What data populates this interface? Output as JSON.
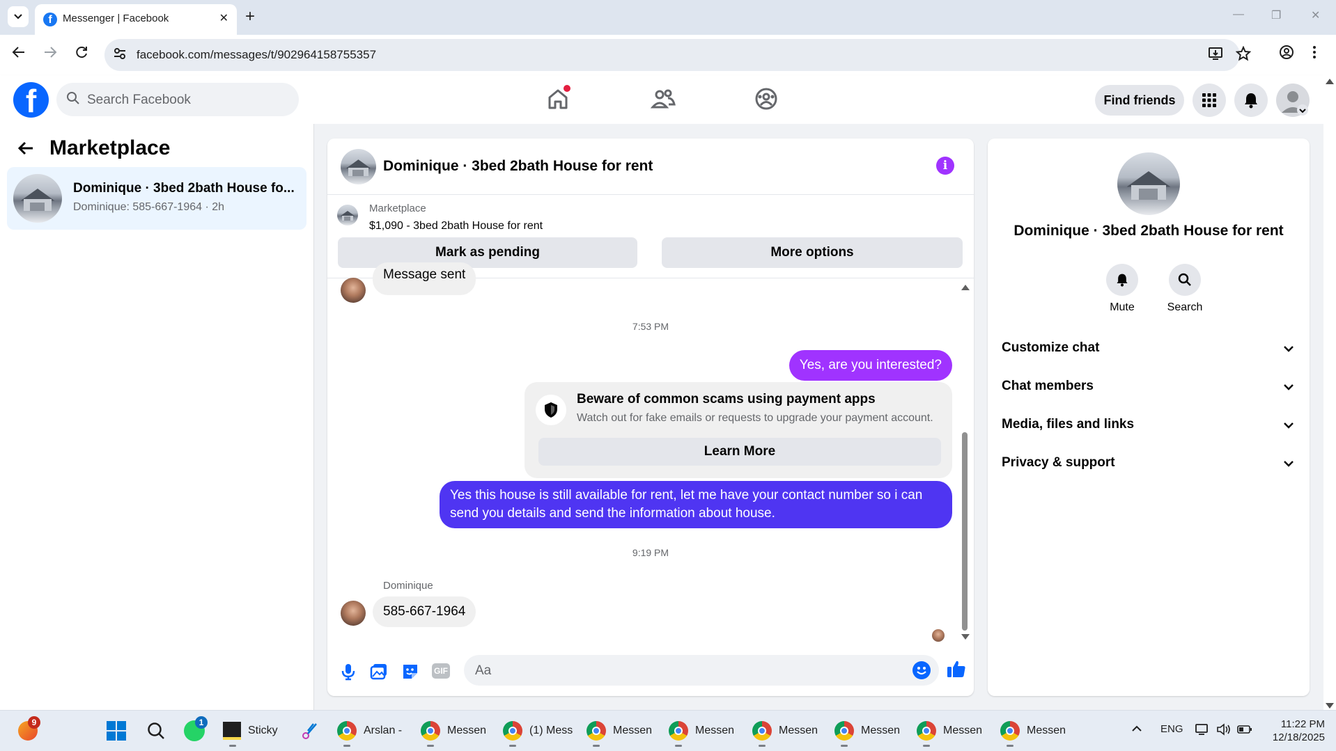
{
  "browser": {
    "tab_title": "Messenger | Facebook",
    "url": "facebook.com/messages/t/902964158755357"
  },
  "fb": {
    "search_placeholder": "Search Facebook",
    "find_friends": "Find friends"
  },
  "left": {
    "title": "Marketplace",
    "conversation": {
      "name": "Dominique · 3bed 2bath House fo...",
      "preview": "Dominique: 585-667-1964 · 2h"
    }
  },
  "chat": {
    "title": "Dominique · 3bed 2bath House for rent",
    "listing_label": "Marketplace",
    "listing_value": "$1,090 - 3bed 2bath House for rent",
    "mark_pending": "Mark as pending",
    "more_options": "More options",
    "messages": {
      "m1": "Message sent",
      "ts1": "7:53 PM",
      "m2": "Yes, are you interested?",
      "scam_title": "Beware of common scams using payment apps",
      "scam_sub": "Watch out for fake emails or requests to upgrade your payment account.",
      "learn_more": "Learn More",
      "m3": "Yes this house is still available for rent, let me have your contact number so i can send you details and send the information about house.",
      "ts2": "9:19 PM",
      "sender": "Dominique",
      "m4": "585-667-1964"
    },
    "composer_placeholder": "Aa",
    "gif_label": "GIF",
    "colors": {
      "out1": "#a033ff",
      "out2": "#4f35f2"
    }
  },
  "right": {
    "name": "Dominique · 3bed 2bath House for rent",
    "mute": "Mute",
    "search": "Search",
    "rows": [
      "Customize chat",
      "Chat members",
      "Media, files and links",
      "Privacy & support"
    ]
  },
  "taskbar": {
    "edge_badge": "9",
    "whatsapp_badge": "1",
    "items": [
      "Sticky I",
      "Arslan -",
      "Messen",
      "(1) Mess",
      "Messen",
      "Messen",
      "Messen",
      "Messen",
      "Messen",
      "Messen"
    ],
    "lang": "ENG",
    "time": "11:22 PM",
    "date": "12/18/2025"
  }
}
